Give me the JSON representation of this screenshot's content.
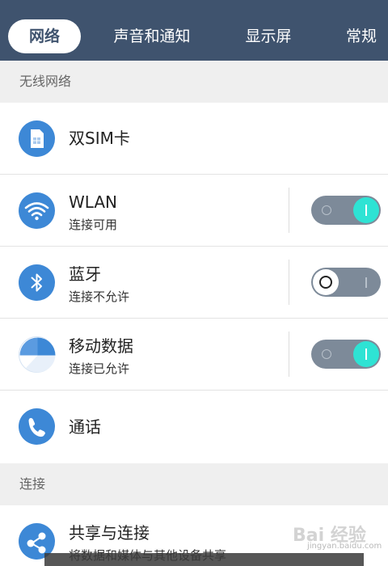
{
  "tabs": [
    {
      "label": "网络",
      "active": true
    },
    {
      "label": "声音和通知",
      "active": false
    },
    {
      "label": "显示屏",
      "active": false
    },
    {
      "label": "常规",
      "active": false
    }
  ],
  "sections": {
    "wireless": "无线网络",
    "connections": "连接"
  },
  "items": {
    "dual_sim": {
      "title": "双SIM卡",
      "icon": "sim-card-icon"
    },
    "wlan": {
      "title": "WLAN",
      "subtitle": "连接可用",
      "toggle": "on",
      "icon": "wifi-icon"
    },
    "bluetooth": {
      "title": "蓝牙",
      "subtitle": "连接不允许",
      "toggle": "off",
      "icon": "bluetooth-icon"
    },
    "mobile_data": {
      "title": "移动数据",
      "subtitle": "连接已允许",
      "toggle": "on",
      "icon": "mobile-data-icon"
    },
    "calls": {
      "title": "通话",
      "icon": "phone-icon"
    },
    "sharing": {
      "title": "共享与连接",
      "subtitle": "将数据和媒体与其他设备共享",
      "icon": "share-icon"
    }
  },
  "watermark": {
    "text": "Bai 经验",
    "url": "jingyan.baidu.com"
  },
  "colors": {
    "header_bg": "#3f536e",
    "icon_blue": "#3d88d6",
    "toggle_on_knob": "#2ee3d4",
    "toggle_track": "#7d8a99"
  }
}
